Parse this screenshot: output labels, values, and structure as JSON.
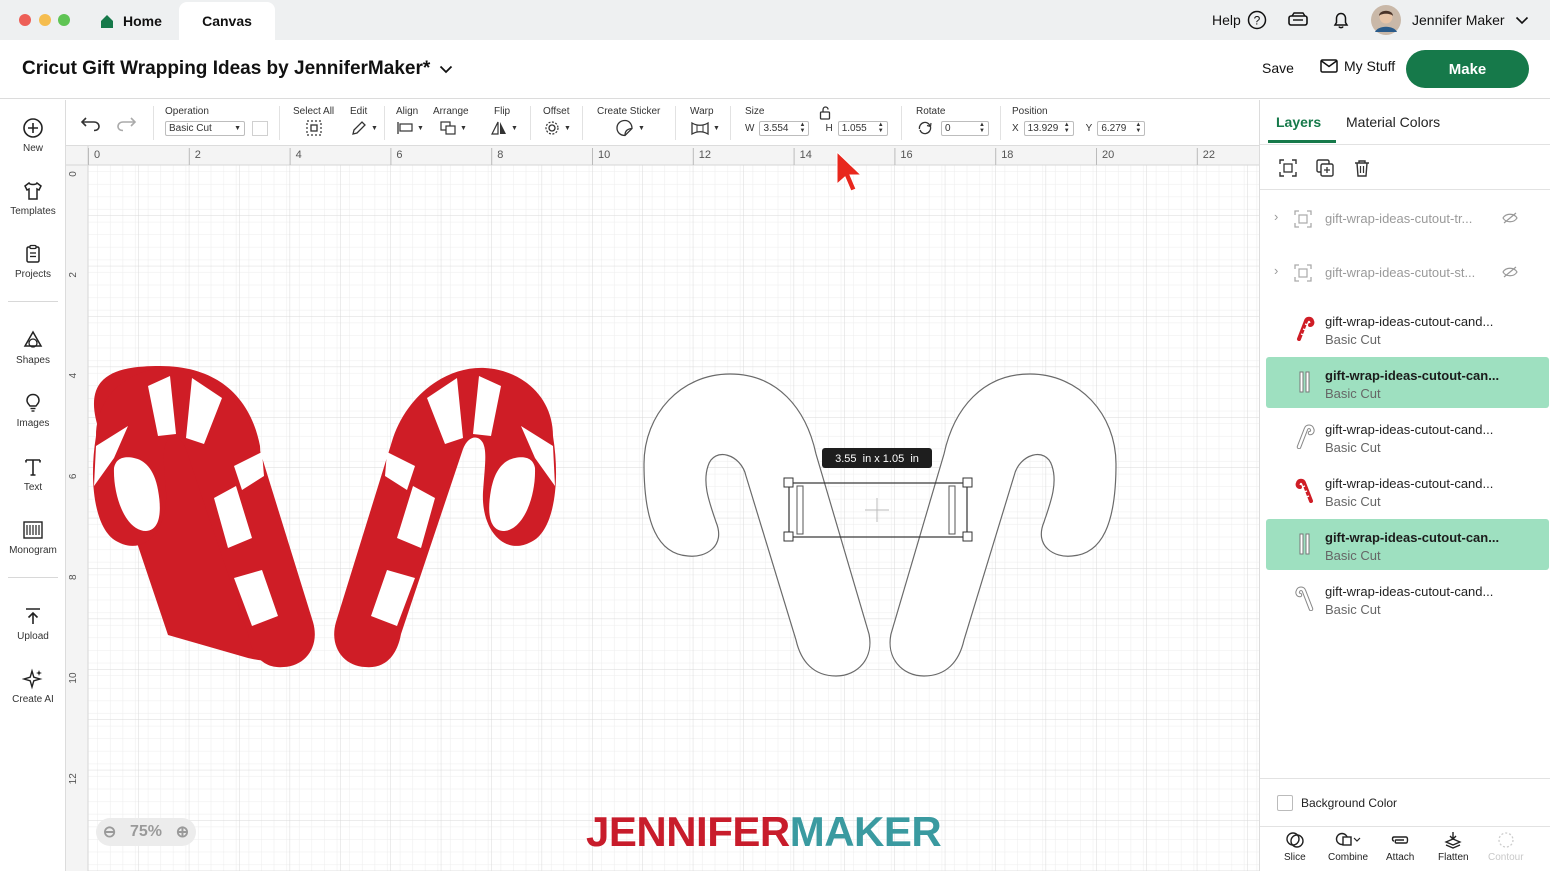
{
  "app": {
    "tabs": {
      "home": "Home",
      "canvas": "Canvas"
    },
    "help_label": "Help",
    "user_name": "Jennifer Maker"
  },
  "project": {
    "title": "Cricut Gift Wrapping Ideas by JenniferMaker*",
    "save_label": "Save",
    "mystuff_label": "My Stuff",
    "make_label": "Make"
  },
  "leftnav": {
    "items": [
      {
        "label": "New",
        "icon": "plus-circle-icon"
      },
      {
        "label": "Templates",
        "icon": "tshirt-icon"
      },
      {
        "label": "Projects",
        "icon": "clipboard-icon"
      },
      {
        "label": "Shapes",
        "icon": "shapes-icon"
      },
      {
        "label": "Images",
        "icon": "lightbulb-icon"
      },
      {
        "label": "Text",
        "icon": "text-icon"
      },
      {
        "label": "Monogram",
        "icon": "monogram-icon"
      },
      {
        "label": "Upload",
        "icon": "upload-icon"
      },
      {
        "label": "Create AI",
        "icon": "sparkle-icon"
      }
    ]
  },
  "toolbar": {
    "operation_label": "Operation",
    "operation_value": "Basic Cut",
    "select_all_label": "Select All",
    "edit_label": "Edit",
    "align_label": "Align",
    "arrange_label": "Arrange",
    "flip_label": "Flip",
    "offset_label": "Offset",
    "create_sticker_label": "Create Sticker",
    "warp_label": "Warp",
    "size_label": "Size",
    "size_w_label": "W",
    "size_w": "3.554",
    "size_h_label": "H",
    "size_h": "1.055",
    "rotate_label": "Rotate",
    "rotate_value": "0",
    "position_label": "Position",
    "pos_x_label": "X",
    "pos_x": "13.929",
    "pos_y_label": "Y",
    "pos_y": "6.279"
  },
  "canvas": {
    "ruler_top": [
      "0",
      "2",
      "4",
      "6",
      "8",
      "10",
      "12",
      "14",
      "16",
      "18",
      "20",
      "22"
    ],
    "ruler_left": [
      "0",
      "2",
      "4",
      "6",
      "8",
      "10",
      "12"
    ],
    "size_tooltip": "3.55  in x 1.05  in",
    "zoom": "75%",
    "watermark_part1": "JENNIFER",
    "watermark_part2": "MAKER",
    "colors": {
      "candy_red": "#cf1d26",
      "accent_green": "#16794a",
      "selected_row": "#9ee0c0",
      "watermark_teal": "#3a9aa0"
    }
  },
  "panel": {
    "tab_layers": "Layers",
    "tab_material_colors": "Material Colors",
    "layers": [
      {
        "name": "gift-wrap-ideas-cutout-tr...",
        "sub": "",
        "type": "group"
      },
      {
        "name": "gift-wrap-ideas-cutout-st...",
        "sub": "",
        "type": "group"
      },
      {
        "name": "gift-wrap-ideas-cutout-cand...",
        "sub": "Basic Cut",
        "type": "candy-red"
      },
      {
        "name": "gift-wrap-ideas-cutout-can...",
        "sub": "Basic Cut",
        "type": "bar",
        "selected": true
      },
      {
        "name": "gift-wrap-ideas-cutout-cand...",
        "sub": "Basic Cut",
        "type": "candy-outline"
      },
      {
        "name": "gift-wrap-ideas-cutout-cand...",
        "sub": "Basic Cut",
        "type": "candy-red"
      },
      {
        "name": "gift-wrap-ideas-cutout-can...",
        "sub": "Basic Cut",
        "type": "bar",
        "selected": true
      },
      {
        "name": "gift-wrap-ideas-cutout-cand...",
        "sub": "Basic Cut",
        "type": "candy-outline"
      }
    ],
    "background_color_label": "Background Color",
    "bottom_tools": [
      "Slice",
      "Combine",
      "Attach",
      "Flatten",
      "Contour"
    ]
  }
}
